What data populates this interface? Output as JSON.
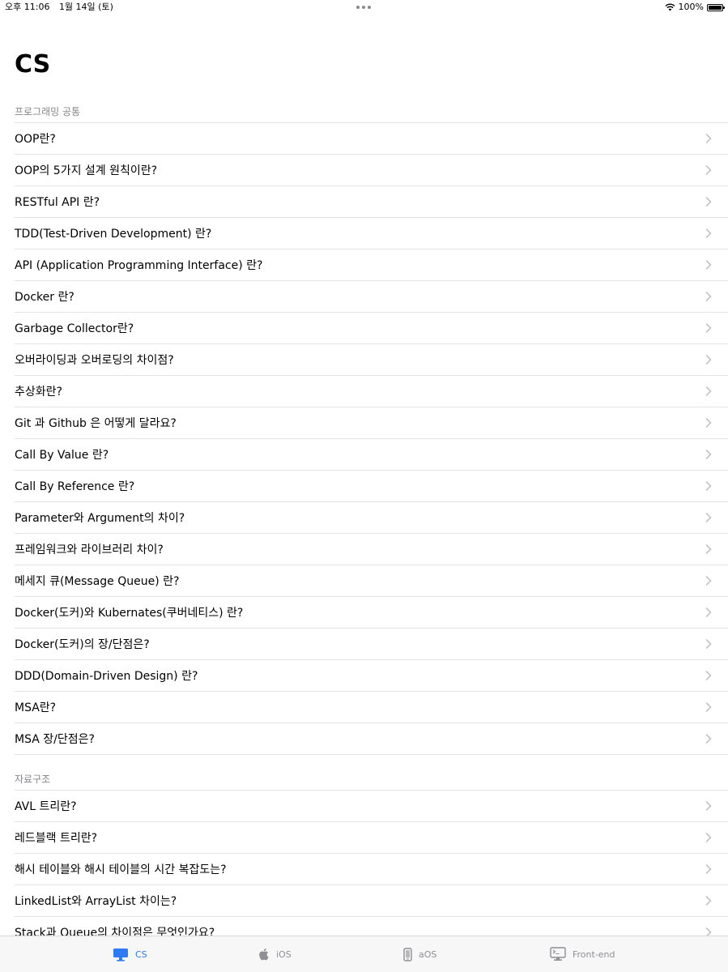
{
  "status_bar": {
    "time": "오후 11:06",
    "date": "1월 14일 (토)",
    "battery": "100%"
  },
  "page_title": "CS",
  "sections": [
    {
      "header": "프로그래밍 공통",
      "items": [
        "OOP란?",
        "OOP의 5가지 설계 원칙이란?",
        "RESTful API 란?",
        "TDD(Test-Driven Development) 란?",
        "API (Application Programming Interface) 란?",
        "Docker 란?",
        "Garbage Collector란?",
        "오버라이딩과 오버로딩의 차이점?",
        "추상화란?",
        "Git 과 Github 은 어떻게 달라요?",
        "Call By Value 란?",
        "Call By Reference 란?",
        "Parameter와 Argument의 차이?",
        "프레임워크와 라이브러리 차이?",
        "메세지 큐(Message Queue) 란?",
        "Docker(도커)와 Kubernates(쿠버네티스) 란?",
        "Docker(도커)의 장/단점은?",
        "DDD(Domain-Driven Design) 란?",
        "MSA란?",
        "MSA 장/단점은?"
      ]
    },
    {
      "header": "자료구조",
      "items": [
        "AVL 트리란?",
        "레드블랙 트리란?",
        "해시 테이블와 해시 테이블의 시간 복잡도는?",
        "LinkedList와 ArrayList 차이는?",
        "Stack과 Queue의 차이점은 무엇인가요?"
      ]
    }
  ],
  "tabs": [
    {
      "label": "CS",
      "icon": "desktop-icon",
      "active": true
    },
    {
      "label": "iOS",
      "icon": "apple-icon",
      "active": false
    },
    {
      "label": "aOS",
      "icon": "phone-icon",
      "active": false
    },
    {
      "label": "Front-end",
      "icon": "terminal-icon",
      "active": false
    }
  ],
  "colors": {
    "accent": "#2d7cf6",
    "inactive_tab": "#8e8e93",
    "section_header": "#86868b",
    "separator": "#e3e3e6"
  }
}
